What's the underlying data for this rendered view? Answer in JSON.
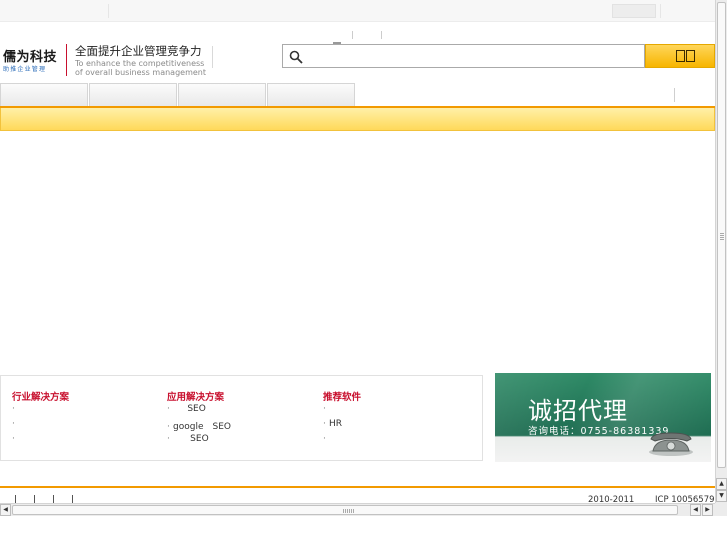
{
  "header": {
    "logo_cn": "儒为科技",
    "logo_sub": "助推企业管理",
    "slogan_cn": "全面提升企业管理竞争力",
    "slogan_en_line1": "To enhance the competitiveness",
    "slogan_en_line2": "of overall business management"
  },
  "search": {
    "placeholder": "",
    "icon": "search-icon"
  },
  "nav": {
    "tabs": [
      "",
      "",
      "",
      ""
    ]
  },
  "columns": [
    {
      "title": "行业解决方案",
      "items": [
        "",
        "",
        ""
      ]
    },
    {
      "title": "应用解决方案",
      "items": [
        "SEO",
        "google　SEO",
        "SEO"
      ]
    },
    {
      "title": "推荐软件",
      "items": [
        "",
        "HR",
        ""
      ]
    }
  ],
  "banner": {
    "title": "诚招代理",
    "phone": "咨询电话：0755-86381339"
  },
  "footer": {
    "copyright": "2010-2011",
    "icp": "ICP 10056579"
  },
  "colors": {
    "accent_orange": "#f29a00",
    "heading_red": "#c8102e",
    "notice_yellow": "#ffd95a"
  }
}
